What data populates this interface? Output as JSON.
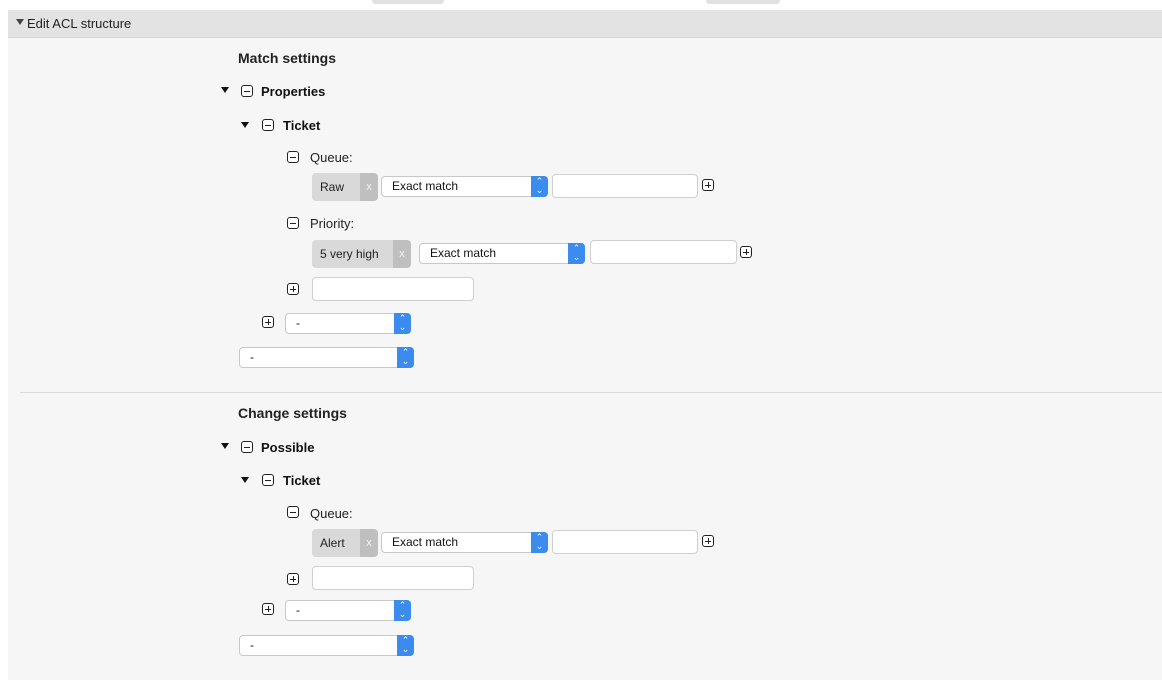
{
  "header": {
    "title": "Edit ACL structure"
  },
  "match": {
    "title": "Match settings",
    "group_label": "Properties",
    "ticket_label": "Ticket",
    "queue": {
      "label": "Queue:",
      "tag": "Raw",
      "tag_close": "x",
      "operator": "Exact match",
      "value": ""
    },
    "priority": {
      "label": "Priority:",
      "tag": "5 very high",
      "tag_close": "x",
      "operator": "Exact match",
      "value": ""
    },
    "new_field_value": "",
    "ticket_add_select": "-",
    "properties_add_select": "-"
  },
  "change": {
    "title": "Change settings",
    "group_label": "Possible",
    "ticket_label": "Ticket",
    "queue": {
      "label": "Queue:",
      "tag": "Alert",
      "tag_close": "x",
      "operator": "Exact match",
      "value": ""
    },
    "new_field_value": "",
    "ticket_add_select": "-",
    "possible_add_select": "-"
  },
  "icons": {
    "collapse": "minus-box-icon",
    "expand": "plus-box-icon",
    "caret": "caret-down-icon",
    "select_arrow": "updown-chevron-icon"
  },
  "colors": {
    "accent": "#3c8cf0",
    "header_bg": "#e3e3e3",
    "tag_bg": "#d9d9d9"
  }
}
